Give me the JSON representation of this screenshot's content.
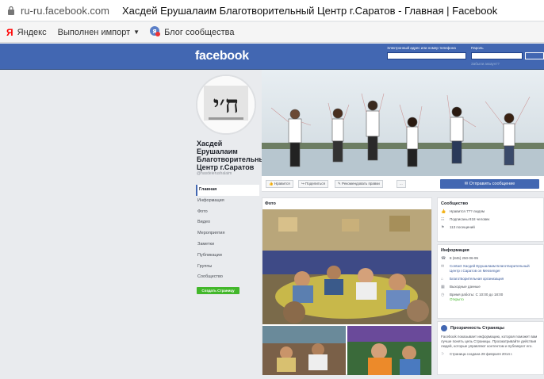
{
  "browser": {
    "url": "ru-ru.facebook.com",
    "title": "Хасдей Ерушалаим Благотворительный Центр г.Саратов - Главная | Facebook"
  },
  "bookmarks": [
    {
      "label": "Яндекс",
      "icon": "yandex-icon"
    },
    {
      "label": "Выполнен импорт",
      "icon": "folder-icon"
    },
    {
      "label": "Блог сообщества",
      "icon": "yandex-blog-icon"
    }
  ],
  "fb": {
    "logo": "facebook",
    "email_label": "Электронный адрес или номер телефона",
    "password_label": "Пароль",
    "forgot": "Забыли аккаунт?"
  },
  "page": {
    "name": "Хасдей Ерушалаим Благотворительный Центр г.Саратов",
    "handle": "@hasdeierushalaim"
  },
  "nav": [
    {
      "label": "Главная",
      "active": true
    },
    {
      "label": "Информация"
    },
    {
      "label": "Фото"
    },
    {
      "label": "Видео"
    },
    {
      "label": "Мероприятия"
    },
    {
      "label": "Заметки"
    },
    {
      "label": "Публикации"
    },
    {
      "label": "Группы"
    },
    {
      "label": "Сообщество"
    }
  ],
  "create_page": "Создать Страницу",
  "actions": {
    "like": "Нравится",
    "share": "Поделиться",
    "suggest": "Рекомендовать правки",
    "more": "...",
    "send": "Отправить сообщение"
  },
  "photos": {
    "header": "Фото"
  },
  "community": {
    "header": "Сообщество",
    "likes": "Нравится 7?? людям",
    "follows": "Подписаны 818 человек",
    "checkins": "113 посещений"
  },
  "info": {
    "header": "Информация",
    "phone": "8 (845) 250-06-95",
    "messenger": "Contact Хасдей Ерушалаим Благотворительный Центр г.Саратов on Messenger",
    "category": "Благотворительная организация",
    "hours_days": "Выходные данные",
    "hours": "Время работы: С 10:00 до 18:00",
    "open": "Открыто"
  },
  "transparency": {
    "header": "Прозрачность Страницы",
    "text": "Facebook показывает информацию, которая поможет вам лучше понять цель Страницы. Просматривайте действия людей, которые управляют контентом и публикуют его.",
    "created": "Страница создана 28 февраля 2014 г."
  }
}
